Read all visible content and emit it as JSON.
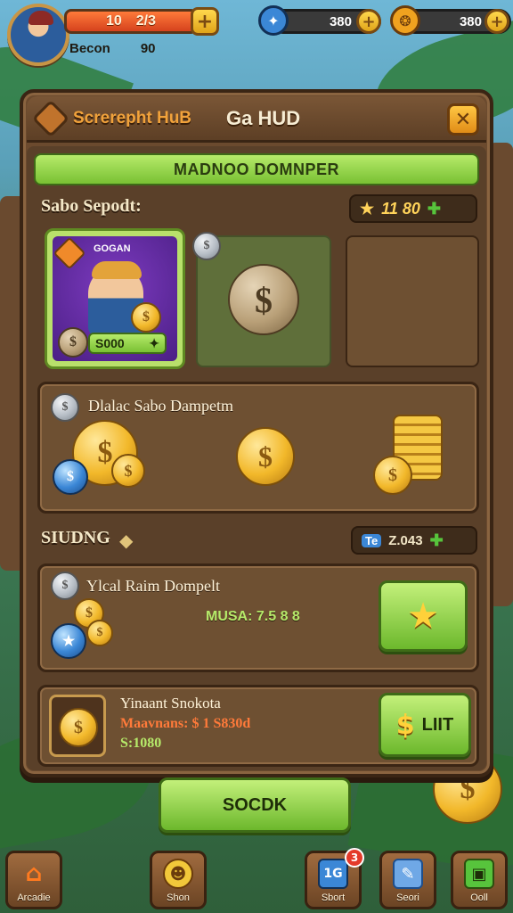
{
  "hud": {
    "level": "10",
    "xp": "2/3",
    "player_name": "Becon",
    "player_value": "90",
    "resource1": "380",
    "resource2": "380"
  },
  "panel": {
    "brand": "Screrepht HuB",
    "title": "Ga HUD",
    "banner": "MADNOO DOMNPER",
    "section1_label": "Sabo Sepodt:",
    "section1_stat": "11 80",
    "card": {
      "badge": "GOGAN",
      "value": "S000"
    },
    "deals_title": "Dlalac Sabo Dampetm",
    "section2_label": "SIUDNG",
    "section2_stat_tag": "Te",
    "section2_stat": "Z.043",
    "item1": {
      "title": "Ylcal Raim Dompelt",
      "stat": "MUSA: 7.5  8  8"
    },
    "item2": {
      "title": "Yinaant Snokota",
      "line2": "Maavnans: $ 1 S830d",
      "line3": "S:1080"
    },
    "buy_button": "LIIT",
    "main_button": "SOCDK"
  },
  "nav": [
    {
      "label": "Arcadie",
      "icon": "house-icon"
    },
    {
      "label": "Shon",
      "icon": "frog-icon"
    },
    {
      "label": "Sbort",
      "icon": "chat-icon",
      "badge": "3",
      "text": "1G"
    },
    {
      "label": "Seori",
      "icon": "note-icon"
    },
    {
      "label": "Ooll",
      "icon": "cash-icon"
    }
  ],
  "colors": {
    "accent_green": "#79c133",
    "panel_brown": "#6b4a2e",
    "gold": "#f2b82a",
    "orange": "#f1a23b"
  }
}
